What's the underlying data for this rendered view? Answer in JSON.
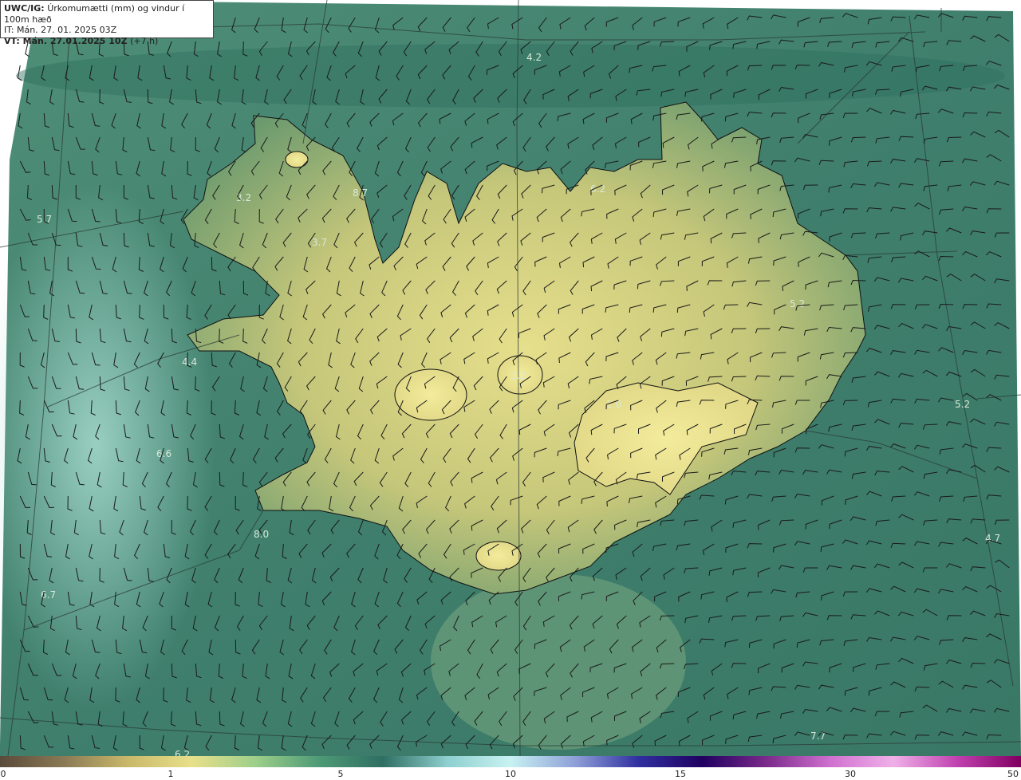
{
  "legend": {
    "product": "UWC/IG:",
    "description": "Úrkomumætti (mm) og vindur í 100m hæð",
    "init_time": "IT: Mán. 27. 01. 2025 03Z",
    "valid_prefix": "VT: Mán. 27.01.2025 10Z",
    "valid_suffix": "(+7 h)"
  },
  "colorbar": {
    "ticks": [
      "0",
      "1",
      "5",
      "10",
      "15",
      "30",
      "50"
    ],
    "colors": [
      "#5a4a3a",
      "#8b7a55",
      "#c9b86a",
      "#e8e08a",
      "#9dcf8a",
      "#4d9a76",
      "#2f6e62",
      "#8ecfcf",
      "#c8f2f2",
      "#8fa0d8",
      "#3030a0",
      "#200060",
      "#7a2a8a",
      "#d070d0",
      "#f0b0e8",
      "#c040b0",
      "#800060"
    ]
  },
  "map_values": [
    {
      "text": "4.2"
    },
    {
      "text": "8.7"
    },
    {
      "text": "3.2"
    },
    {
      "text": "5.7"
    },
    {
      "text": "3.7"
    },
    {
      "text": "6.2"
    },
    {
      "text": "5.2"
    },
    {
      "text": "4.4"
    },
    {
      "text": "1.2"
    },
    {
      "text": "1.0"
    },
    {
      "text": "5.2"
    },
    {
      "text": "6.6"
    },
    {
      "text": "8.0"
    },
    {
      "text": "4.7"
    },
    {
      "text": "6.7"
    },
    {
      "text": "6.2"
    },
    {
      "text": "7.7"
    }
  ]
}
